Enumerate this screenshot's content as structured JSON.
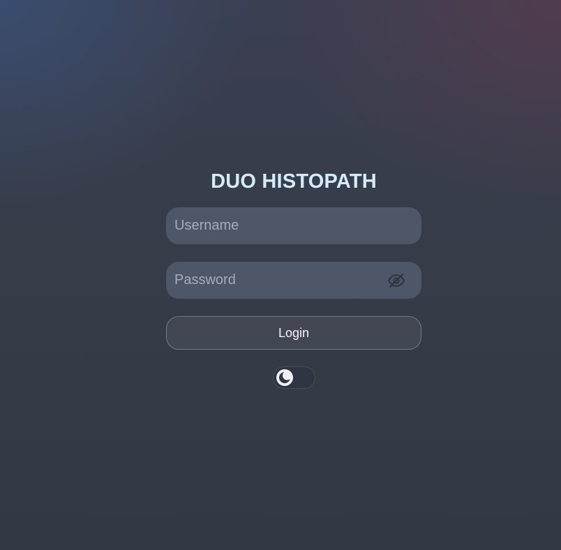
{
  "app": {
    "title": "DUO HISTOPATH"
  },
  "login_form": {
    "username": {
      "value": "",
      "placeholder": "Username"
    },
    "password": {
      "value": "",
      "placeholder": "Password",
      "visibility_icon": "eye-off-icon"
    },
    "login_label": "Login",
    "theme_toggle": {
      "icon": "moon-icon",
      "mode": "dark"
    }
  },
  "colors": {
    "title": "#d4ecfa",
    "field_bg": "#4e5767",
    "button_border": "#737b89",
    "background": "#333a45"
  }
}
